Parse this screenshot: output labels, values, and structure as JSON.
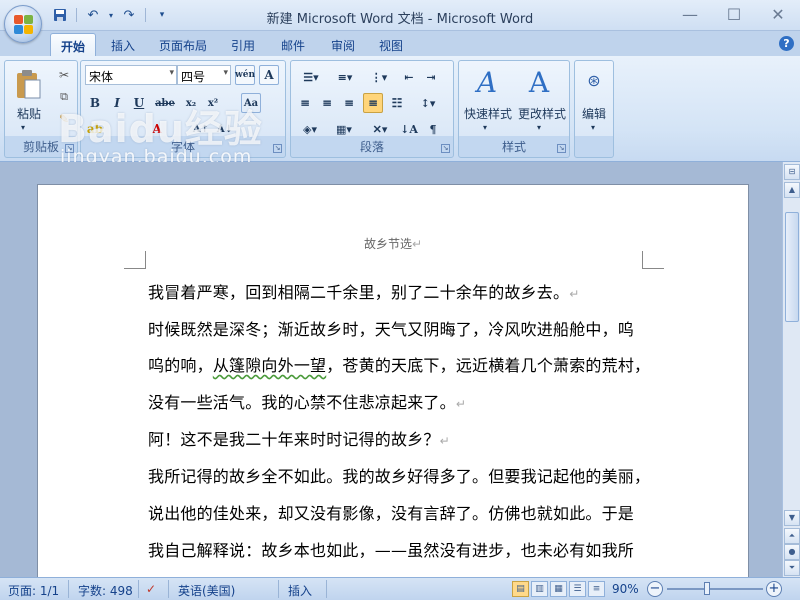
{
  "window": {
    "title": "新建 Microsoft Word 文档 - Microsoft Word",
    "controls": [
      "—",
      "☐",
      "✕"
    ]
  },
  "qat": {
    "save": "save-icon",
    "undo": "undo-icon",
    "redo": "redo-icon",
    "customize": "▾"
  },
  "tabs": [
    {
      "label": "开始",
      "active": true
    },
    {
      "label": "插入"
    },
    {
      "label": "页面布局"
    },
    {
      "label": "引用"
    },
    {
      "label": "邮件"
    },
    {
      "label": "审阅"
    },
    {
      "label": "视图"
    }
  ],
  "ribbon": {
    "clipboard": {
      "label": "剪贴板",
      "paste": "粘贴"
    },
    "font": {
      "label": "字体",
      "name": "宋体",
      "size": "四号"
    },
    "paragraph": {
      "label": "段落"
    },
    "styles": {
      "label": "样式",
      "quick": "快速样式",
      "change": "更改样式"
    },
    "editing": {
      "label": "编辑"
    }
  },
  "watermark": {
    "brand": "Baidu经验",
    "url": "jingyan.baidu.com"
  },
  "document": {
    "header": "故乡节选",
    "lines": [
      "我冒着严寒，回到相隔二千余里，别了二十余年的故乡去。",
      "时候既然是深冬；渐近故乡时，天气又阴晦了，冷风吹进船舱中，呜",
      "呜的响，",
      "从篷隙向外一望",
      "，苍黄的天底下，远近横着几个萧索的荒村，",
      "没有一些活气。我的心禁不住悲凉起来了。",
      "阿！这不是我二十年来时时记得的故乡？",
      "我所记得的故乡全不如此。我的故乡好得多了。但要我记起他的美丽，",
      "说出他的佳处来，却又没有影像，没有言辞了。仿佛也就如此。于是",
      "我自己解释说：故乡本也如此，——虽然没有进步，也未必有如我所"
    ],
    "paragraph_mark": "↵"
  },
  "status": {
    "page": "页面: 1/1",
    "words": "字数: 498",
    "language": "英语(美国)",
    "mode": "插入",
    "zoom": "90%"
  },
  "colors": {
    "accent": "#15428b",
    "ribbon": "#dbe8f7",
    "doc_bg": "#a5b9d5"
  }
}
